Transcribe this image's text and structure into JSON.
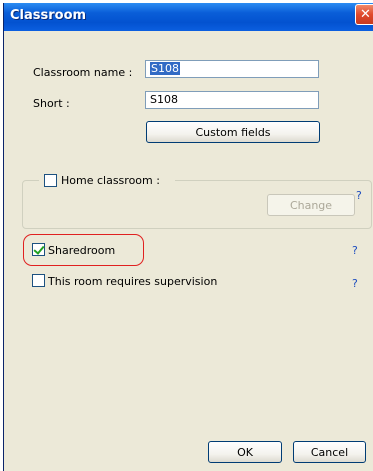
{
  "window": {
    "title": "Classroom",
    "close_glyph": "✕"
  },
  "fields": {
    "name_label": "Classroom name :",
    "name_value": "S108",
    "short_label": "Short :",
    "short_value": "S108",
    "custom_fields_label": "Custom fields"
  },
  "home": {
    "label": "Home classroom :",
    "change_label": "Change",
    "help": "?"
  },
  "options": {
    "sharedroom_label": "Sharedroom",
    "sharedroom_checked": true,
    "sharedroom_help": "?",
    "supervision_label": "This room requires supervision",
    "supervision_checked": false,
    "supervision_help": "?"
  },
  "footer": {
    "ok_label": "OK",
    "cancel_label": "Cancel"
  },
  "colors": {
    "title_bar": "#0a5ed8",
    "dialog_bg": "#ece9d8",
    "highlight": "#e02020",
    "help": "#1f4fbf"
  }
}
